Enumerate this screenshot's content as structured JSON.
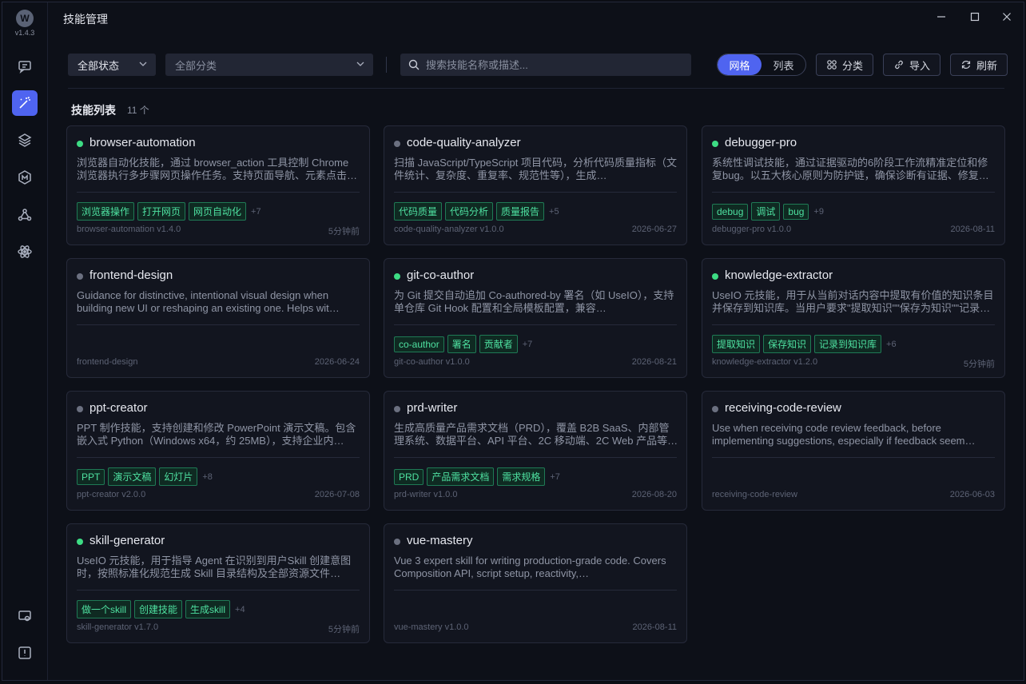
{
  "app": {
    "version": "v1.4.3",
    "title": "技能管理"
  },
  "toolbar": {
    "status_filter": "全部状态",
    "category_filter": "全部分类",
    "search_placeholder": "搜索技能名称或描述...",
    "view_grid": "网格",
    "view_list": "列表",
    "category_btn": "分类",
    "import_btn": "导入",
    "refresh_btn": "刷新"
  },
  "section": {
    "title": "技能列表",
    "count": "11 个"
  },
  "colors": {
    "accent": "#4f64f0",
    "active_dot": "#3ddc84",
    "inactive_dot": "#6b7080",
    "tag_text": "#4ee0a0"
  },
  "cards": [
    {
      "name": "browser-automation",
      "active": true,
      "desc": "浏览器自动化技能，通过 browser_action 工具控制 Chrome 浏览器执行多步骤网页操作任务。支持页面导航、元素点击…",
      "tags": [
        "浏览器操作",
        "打开网页",
        "网页自动化"
      ],
      "more": "+7",
      "foot": "browser-automation v1.4.0",
      "time": "5分钟前"
    },
    {
      "name": "code-quality-analyzer",
      "active": false,
      "desc": "扫描 JavaScript/TypeScript 项目代码，分析代码质量指标（文件统计、复杂度、重复率、规范性等），生成…",
      "tags": [
        "代码质量",
        "代码分析",
        "质量报告"
      ],
      "more": "+5",
      "foot": "code-quality-analyzer v1.0.0",
      "time": "2026-06-27"
    },
    {
      "name": "debugger-pro",
      "active": true,
      "desc": "系统性调试技能，通过证据驱动的6阶段工作流精准定位和修复bug。以五大核心原则为防护链，确保诊断有证据、修复…",
      "tags": [
        "debug",
        "调试",
        "bug"
      ],
      "more": "+9",
      "foot": "debugger-pro v1.0.0",
      "time": "2026-08-11"
    },
    {
      "name": "frontend-design",
      "active": false,
      "desc": "Guidance for distinctive, intentional visual design when building new UI or reshaping an existing one. Helps wit…",
      "tags": [],
      "more": "",
      "foot": "frontend-design",
      "time": "2026-06-24"
    },
    {
      "name": "git-co-author",
      "active": true,
      "desc": "为 Git 提交自动追加 Co-authored-by 署名（如 UseIO），支持单仓库 Git Hook 配置和全局模板配置，兼容…",
      "tags": [
        "co-author",
        "署名",
        "贡献者"
      ],
      "more": "+7",
      "foot": "git-co-author v1.0.0",
      "time": "2026-08-21"
    },
    {
      "name": "knowledge-extractor",
      "active": true,
      "desc": "UseIO 元技能，用于从当前对话内容中提取有价值的知识条目并保存到知识库。当用户要求\"提取知识\"\"保存为知识\"\"记录…",
      "tags": [
        "提取知识",
        "保存知识",
        "记录到知识库"
      ],
      "more": "+6",
      "foot": "knowledge-extractor v1.2.0",
      "time": "5分钟前"
    },
    {
      "name": "ppt-creator",
      "active": false,
      "desc": "PPT 制作技能，支持创建和修改 PowerPoint 演示文稿。包含嵌入式 Python（Windows x64，约 25MB），支持企业内…",
      "tags": [
        "PPT",
        "演示文稿",
        "幻灯片"
      ],
      "more": "+8",
      "foot": "ppt-creator v2.0.0",
      "time": "2026-07-08"
    },
    {
      "name": "prd-writer",
      "active": false,
      "desc": "生成高质量产品需求文档（PRD），覆盖 B2B SaaS、内部管理系统、数据平台、API 平台、2C 移动端、2C Web 产品等…",
      "tags": [
        "PRD",
        "产品需求文档",
        "需求规格"
      ],
      "more": "+7",
      "foot": "prd-writer v1.0.0",
      "time": "2026-08-20"
    },
    {
      "name": "receiving-code-review",
      "active": false,
      "desc": "Use when receiving code review feedback, before implementing suggestions, especially if feedback seem…",
      "tags": [],
      "more": "",
      "foot": "receiving-code-review",
      "time": "2026-06-03"
    },
    {
      "name": "skill-generator",
      "active": true,
      "desc": "UseIO 元技能，用于指导 Agent 在识别到用户Skill 创建意图时，按照标准化规范生成 Skill 目录结构及全部资源文件（含…",
      "tags": [
        "做一个skill",
        "创建技能",
        "生成skill"
      ],
      "more": "+4",
      "foot": "skill-generator v1.7.0",
      "time": "5分钟前"
    },
    {
      "name": "vue-mastery",
      "active": false,
      "desc": "Vue 3 expert skill for writing production-grade code. Covers Composition API, script setup, reactivity,…",
      "tags": [],
      "more": "",
      "foot": "vue-mastery v1.0.0",
      "time": "2026-08-11"
    }
  ]
}
